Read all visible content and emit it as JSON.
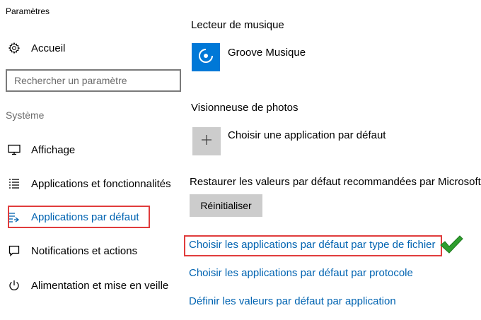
{
  "window": {
    "title": "Paramètres"
  },
  "sidebar": {
    "home_label": "Accueil",
    "search": {
      "placeholder": "Rechercher un paramètre",
      "value": ""
    },
    "section_label": "Système",
    "items": [
      {
        "label": "Affichage",
        "icon": "monitor-icon"
      },
      {
        "label": "Applications et fonctionnalités",
        "icon": "list-icon"
      },
      {
        "label": "Applications par défaut",
        "icon": "default-apps-icon",
        "active": true
      },
      {
        "label": "Notifications et actions",
        "icon": "notification-icon"
      },
      {
        "label": "Alimentation et mise en veille",
        "icon": "power-icon"
      }
    ]
  },
  "main": {
    "music": {
      "heading": "Lecteur de musique",
      "app": "Groove Musique",
      "tile_color": "#0078d7",
      "icon": "groove-icon"
    },
    "photos": {
      "heading": "Visionneuse de photos",
      "app": "Choisir une application par défaut",
      "tile_color": "#cccccc",
      "icon": "plus-icon"
    },
    "reset": {
      "heading": "Restaurer les valeurs par défaut recommandées par Microsoft",
      "button_label": "Réinitialiser"
    },
    "links": [
      "Choisir les applications par défaut par type de fichier",
      "Choisir les applications par défaut par protocole",
      "Définir les valeurs par défaut par application"
    ]
  },
  "colors": {
    "accent": "#0063b1",
    "highlight": "#e03c3c",
    "check": "#2e9e2e"
  }
}
